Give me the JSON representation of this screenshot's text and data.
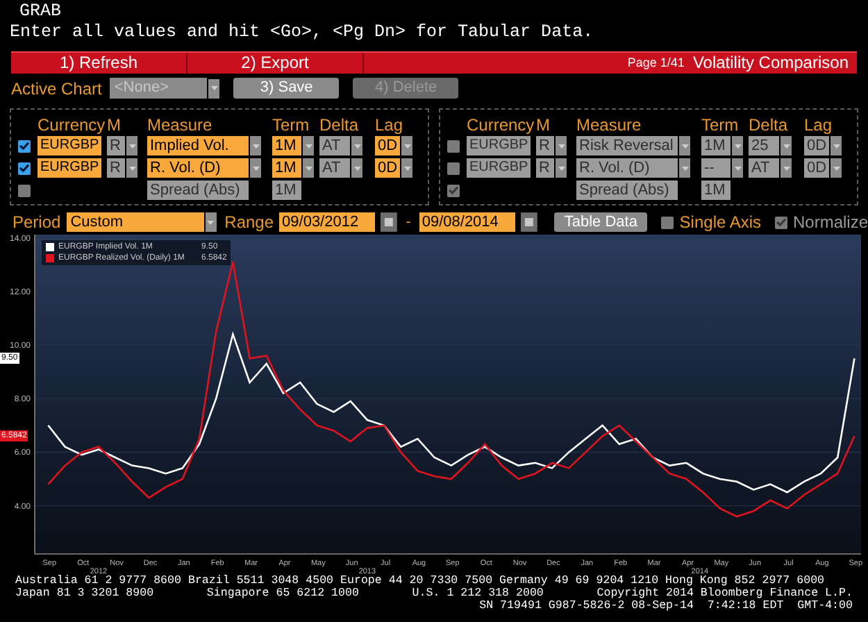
{
  "header": {
    "command": "GRAB",
    "prompt": "Enter all values and hit <Go>, <Pg Dn> for Tabular Data."
  },
  "toolbar": {
    "buttons": [
      "1) Refresh",
      "2) Export"
    ],
    "page": "Page 1/41",
    "title": "Volatility Comparison"
  },
  "active_chart": {
    "label": "Active Chart",
    "value": "<None>",
    "buttons": [
      {
        "label": "3) Save",
        "disabled": false
      },
      {
        "label": "4) Delete",
        "disabled": true
      }
    ]
  },
  "panels": [
    {
      "columns": [
        "Currency",
        "M",
        "Measure",
        "Term",
        "Delta",
        "Lag"
      ],
      "rows": [
        {
          "checked": true,
          "active": true,
          "currency": "EURGBP",
          "m": "R",
          "measure": "Implied Vol.",
          "term": "1M",
          "delta": "AT",
          "lag": "0D"
        },
        {
          "checked": true,
          "active": true,
          "currency": "EURGBP",
          "m": "R",
          "measure": "R. Vol. (D)",
          "term": "1M",
          "delta": "AT",
          "lag": "0D"
        },
        {
          "checked": false,
          "active": false,
          "measure": "Spread (Abs)",
          "term": "1M"
        }
      ]
    },
    {
      "columns": [
        "Currency",
        "M",
        "Measure",
        "Term",
        "Delta",
        "Lag"
      ],
      "rows": [
        {
          "checked": false,
          "active": false,
          "currency": "EURGBP",
          "m": "R",
          "measure": "Risk Reversal",
          "term": "1M",
          "delta": "25",
          "lag": "0D"
        },
        {
          "checked": false,
          "active": false,
          "currency": "EURGBP",
          "m": "R",
          "measure": "R. Vol. (D)",
          "term": "--",
          "delta": "AT",
          "lag": "0D"
        },
        {
          "checked": true,
          "disabled": true,
          "active": false,
          "measure": "Spread (Abs)",
          "term": "1M"
        }
      ]
    }
  ],
  "period": {
    "label": "Period",
    "value": "Custom",
    "range_label": "Range",
    "start": "09/03/2012",
    "separator": "-",
    "end": "09/08/2014",
    "table_button": "Table Data",
    "options": [
      {
        "label": "Single Axis",
        "checked": false,
        "disabled": false
      },
      {
        "label": "Normalize",
        "checked": true,
        "disabled": true
      }
    ]
  },
  "chart": {
    "legend_values": [
      "9.50",
      "6.5842"
    ],
    "last_values": [
      {
        "text": "9.50",
        "color": "#ffffff"
      },
      {
        "text": "6.5842",
        "color": "#e0141e"
      }
    ],
    "chart_data": {
      "type": "line",
      "categories": [
        "Sep",
        null,
        "Oct",
        null,
        "Nov",
        null,
        "Dec",
        null,
        "Jan",
        null,
        "Feb",
        null,
        "Mar",
        null,
        "Apr",
        null,
        "May",
        null,
        "Jun",
        null,
        "Jul",
        null,
        "Aug",
        null,
        "Sep",
        null,
        "Oct",
        null,
        "Nov",
        null,
        "Dec",
        null,
        "Jan",
        null,
        "Feb",
        null,
        "Mar",
        null,
        "Apr",
        null,
        "May",
        null,
        "Jun",
        null,
        "Jul",
        null,
        "Aug",
        null,
        "Sep"
      ],
      "series": [
        {
          "name": "EURGBP Implied Vol. 1M",
          "color": "#ffffff",
          "values": [
            7.0,
            6.2,
            5.9,
            6.1,
            5.8,
            5.5,
            5.4,
            5.2,
            5.4,
            6.3,
            8.0,
            10.4,
            8.6,
            9.3,
            8.2,
            8.6,
            7.8,
            7.5,
            7.9,
            7.2,
            7.0,
            6.2,
            6.5,
            5.8,
            5.5,
            5.9,
            6.2,
            5.8,
            5.5,
            5.6,
            5.4,
            6.0,
            6.5,
            7.0,
            6.3,
            6.5,
            5.8,
            5.5,
            5.6,
            5.2,
            5.0,
            4.9,
            4.6,
            4.8,
            4.5,
            4.9,
            5.2,
            5.8,
            9.5
          ]
        },
        {
          "name": "EURGBP Realized Vol. (Daily) 1M",
          "color": "#e0141e",
          "values": [
            4.8,
            5.5,
            6.0,
            6.2,
            5.6,
            4.9,
            4.3,
            4.7,
            5.0,
            6.5,
            10.5,
            13.1,
            9.5,
            9.6,
            8.3,
            7.6,
            7.0,
            6.8,
            6.4,
            6.9,
            7.0,
            6.0,
            5.3,
            5.1,
            5.0,
            5.6,
            6.3,
            5.5,
            5.0,
            5.2,
            5.6,
            5.4,
            6.0,
            6.6,
            7.0,
            6.4,
            5.8,
            5.2,
            5.0,
            4.5,
            3.9,
            3.6,
            3.8,
            4.2,
            3.9,
            4.4,
            4.8,
            5.2,
            6.6
          ]
        }
      ],
      "ylim": [
        2.2,
        14.2
      ],
      "grid": true,
      "legend": "top-left",
      "yticks": [
        {
          "value": 4,
          "label": "4.00"
        },
        {
          "value": 6,
          "label": "6.00"
        },
        {
          "value": 8,
          "label": "8.00"
        },
        {
          "value": 10,
          "label": "10.00"
        },
        {
          "value": 12,
          "label": "12.00"
        },
        {
          "value": 14,
          "label": "14.00"
        }
      ],
      "annotations": [
        "2012",
        "2013",
        "2014"
      ]
    }
  },
  "footer": {
    "lines": [
      [
        "Australia 61 2 9777 8600 Brazil 5511 3048 4500 Europe 44 20 7330 7500 Germany 49 69 9204 1210 Hong Kong 852 2977 6000"
      ],
      [
        "Japan 81 3 3201 8900",
        "Singapore 65 6212 1000",
        "U.S. 1 212 318 2000",
        "Copyright 2014 Bloomberg Finance L.P."
      ],
      [
        "SN 719491 G987-5826-2 08-Sep-14  7:42:18 EDT  GMT-4:00"
      ]
    ]
  }
}
